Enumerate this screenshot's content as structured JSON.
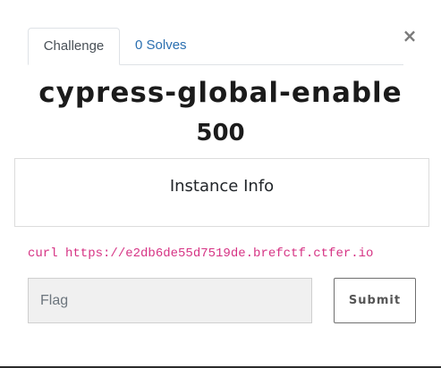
{
  "modal": {
    "close_symbol": "×",
    "tabs": [
      {
        "label": "Challenge",
        "active": true
      },
      {
        "label": "0 Solves",
        "active": false
      }
    ],
    "challenge_name": "cypress-global-enable",
    "challenge_value": "500",
    "instance": {
      "title": "Instance Info",
      "command": "curl https://e2db6de55d7519de.brefctf.ctfer.io"
    },
    "flag_input": {
      "value": "",
      "placeholder": "Flag"
    },
    "submit_label": "Submit"
  },
  "colors": {
    "tab_link": "#2a6fb0",
    "code_text": "#d63384",
    "input_bg": "#f0f0f0"
  }
}
